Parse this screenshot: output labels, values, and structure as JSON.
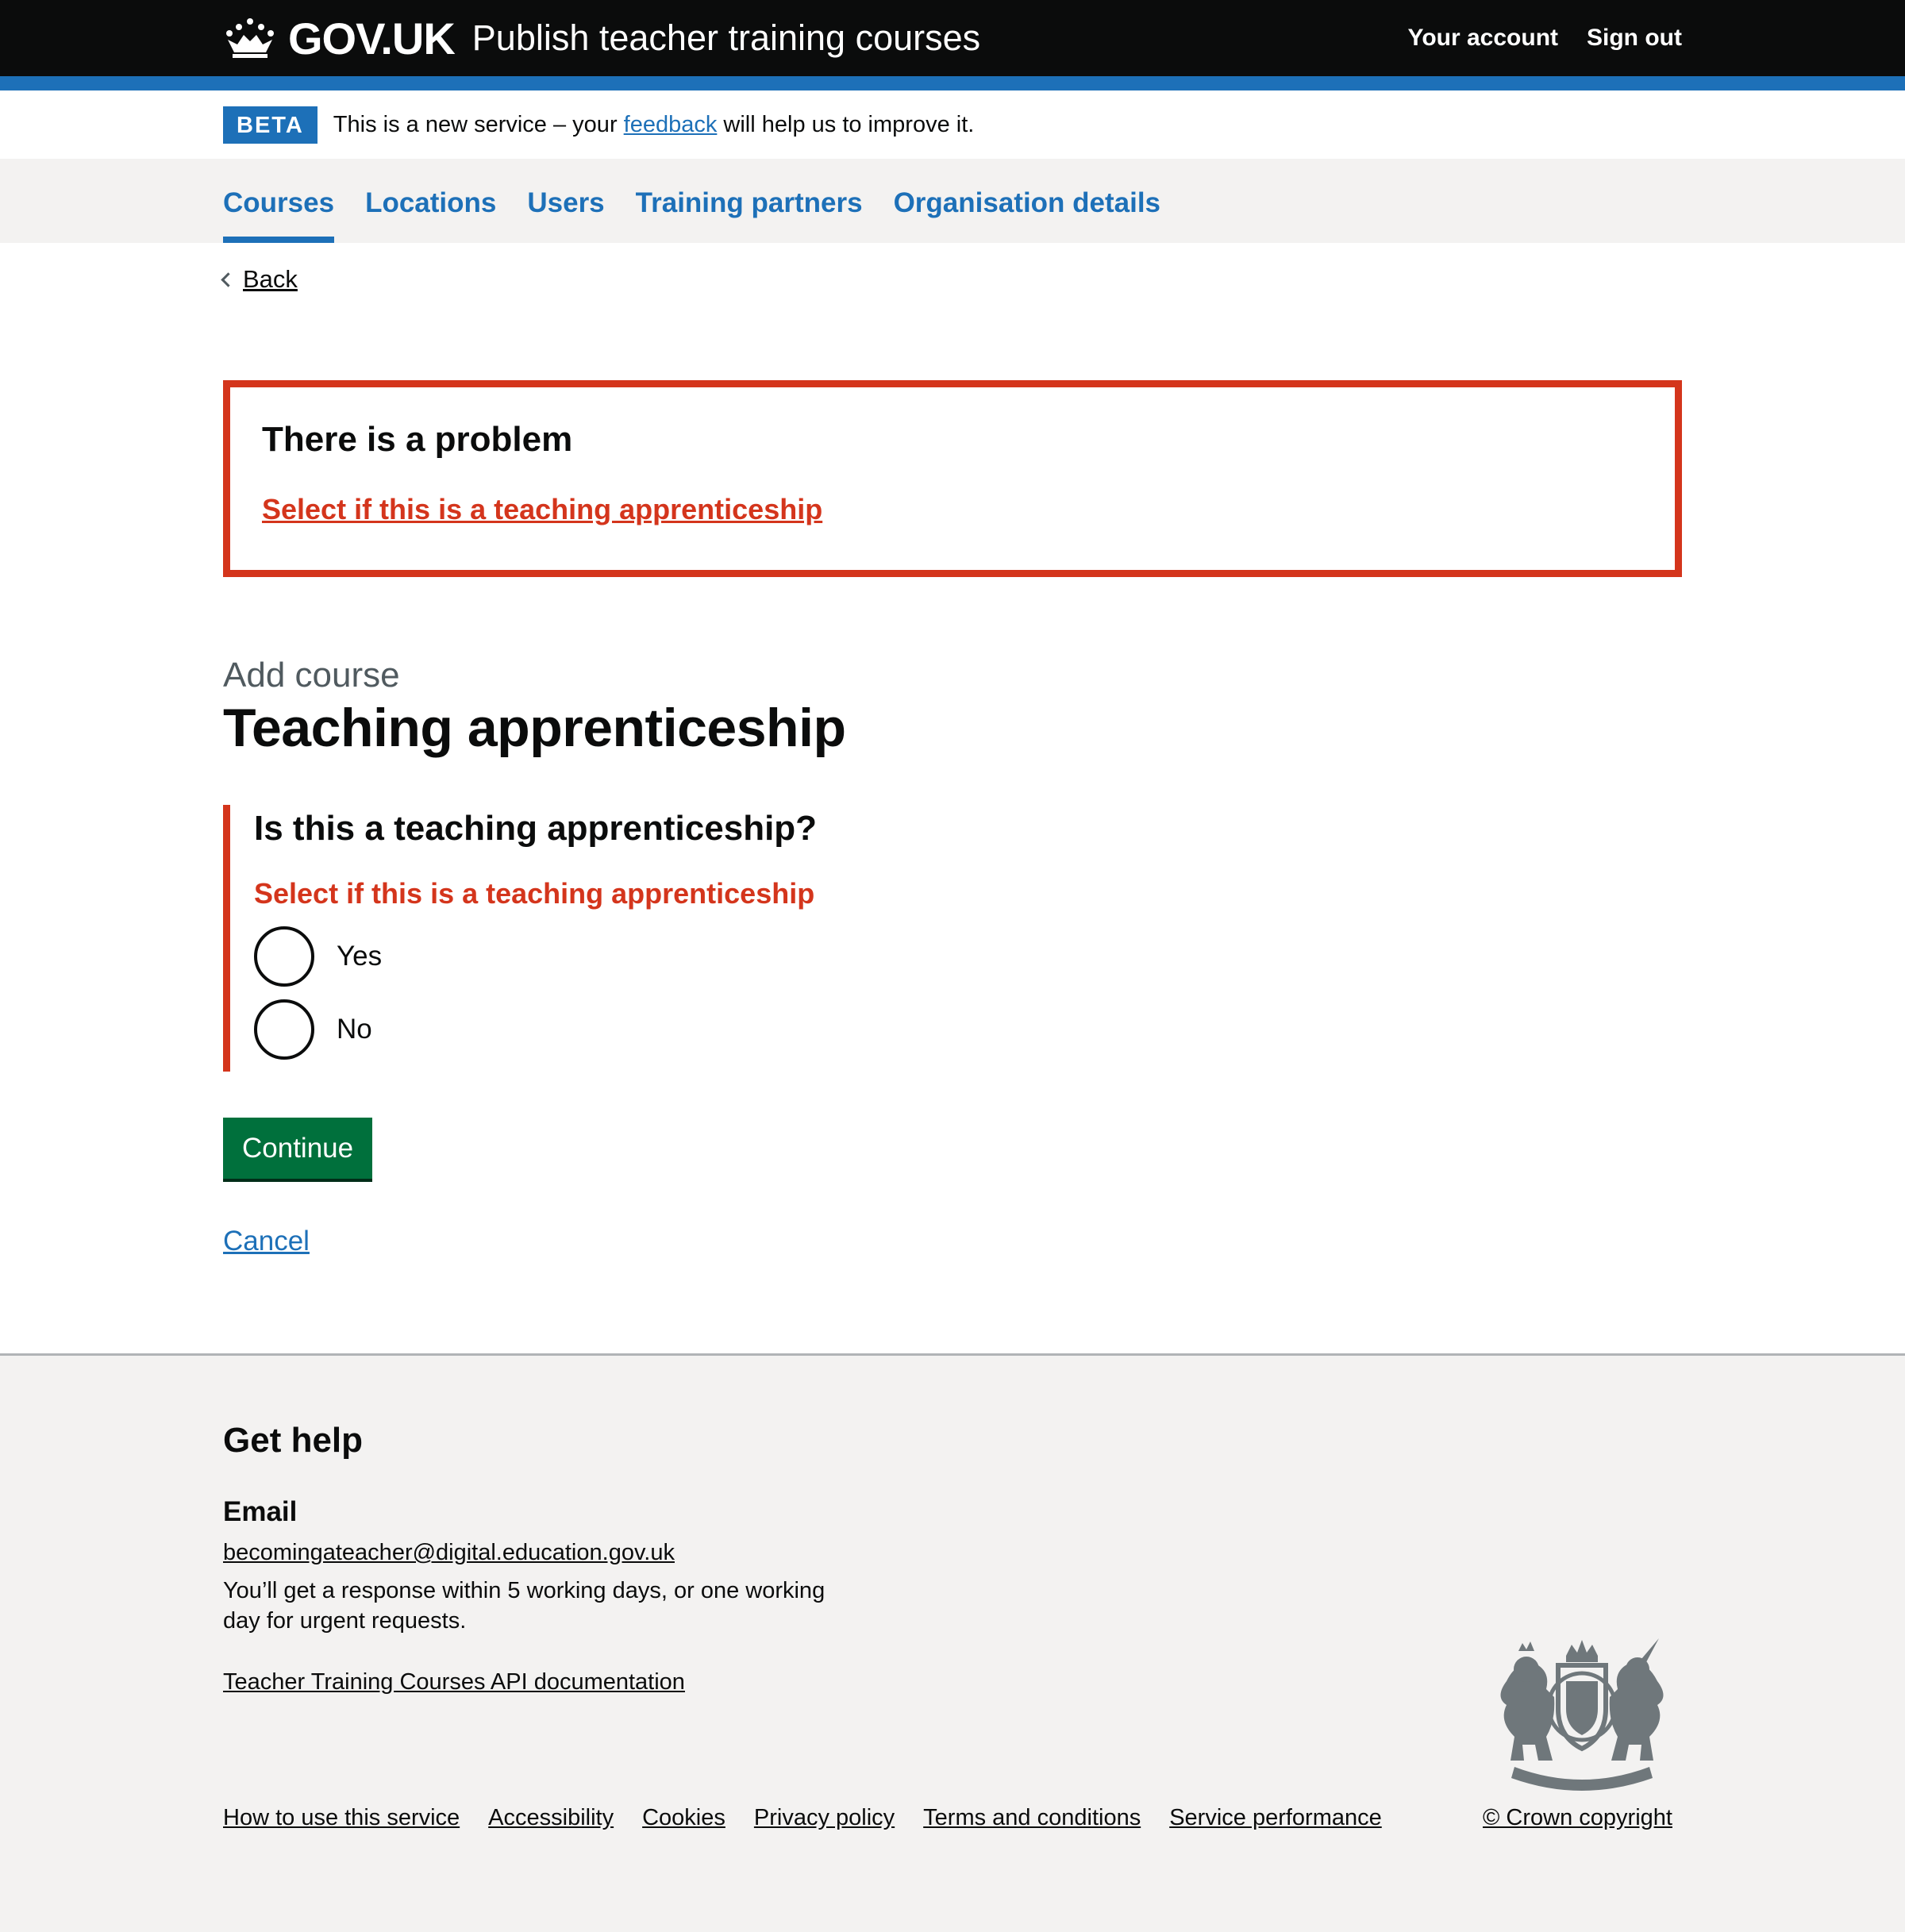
{
  "header": {
    "brand": "GOV.UK",
    "service_name": "Publish teacher training courses",
    "links": [
      "Your account",
      "Sign out"
    ]
  },
  "beta": {
    "tag": "BETA",
    "text_before": "This is a new service – your ",
    "link": "feedback",
    "text_after": " will help us to improve it."
  },
  "nav": {
    "items": [
      {
        "label": "Courses",
        "active": true
      },
      {
        "label": "Locations"
      },
      {
        "label": "Users"
      },
      {
        "label": "Training partners"
      },
      {
        "label": "Organisation details"
      }
    ]
  },
  "back_link": "Back",
  "error_summary": {
    "title": "There is a problem",
    "link": "Select if this is a teaching apprenticeship"
  },
  "page": {
    "caption": "Add course",
    "title": "Teaching apprenticeship",
    "question": "Is this a teaching apprenticeship?",
    "error_message": "Select if this is a teaching apprenticeship",
    "options": [
      "Yes",
      "No"
    ],
    "continue_label": "Continue",
    "cancel_label": "Cancel"
  },
  "footer": {
    "title": "Get help",
    "email_heading": "Email",
    "email": "becomingateacher@digital.education.gov.uk",
    "response": "You’ll get a response within 5 working days, or one working day for urgent requests.",
    "api_link": "Teacher Training Courses API documentation",
    "links": [
      "How to use this service",
      "Accessibility",
      "Cookies",
      "Privacy policy",
      "Terms and conditions",
      "Service performance"
    ],
    "copyright": "© Crown copyright"
  },
  "colors": {
    "header_bg": "#0b0c0c",
    "brand_blue": "#1d70b8",
    "error_red": "#d4351c",
    "button_green": "#00703c",
    "footer_bg": "#f3f2f1"
  }
}
